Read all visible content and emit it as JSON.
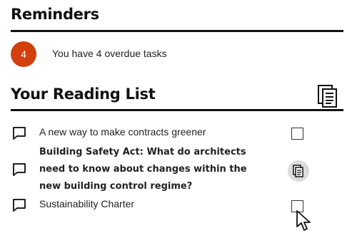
{
  "reminders": {
    "title": "Reminders",
    "badge_count": "4",
    "message": "You have 4 overdue tasks",
    "badge_color": "#d2400e"
  },
  "reading_list": {
    "title": "Your Reading List",
    "header_icon": "documents-icon",
    "items": [
      {
        "title": "A new way to make contracts greener",
        "icon": "comment-icon",
        "action": "checkbox",
        "checked": false,
        "bold": false
      },
      {
        "title": "Building Safety Act: What do architects need to know about changes within the new building control regime?",
        "icon": "comment-icon",
        "action": "documents-icon",
        "checked": true,
        "bold": true
      },
      {
        "title": "Sustainability Charter",
        "icon": "comment-icon",
        "action": "checkbox",
        "checked": false,
        "bold": false
      }
    ]
  }
}
